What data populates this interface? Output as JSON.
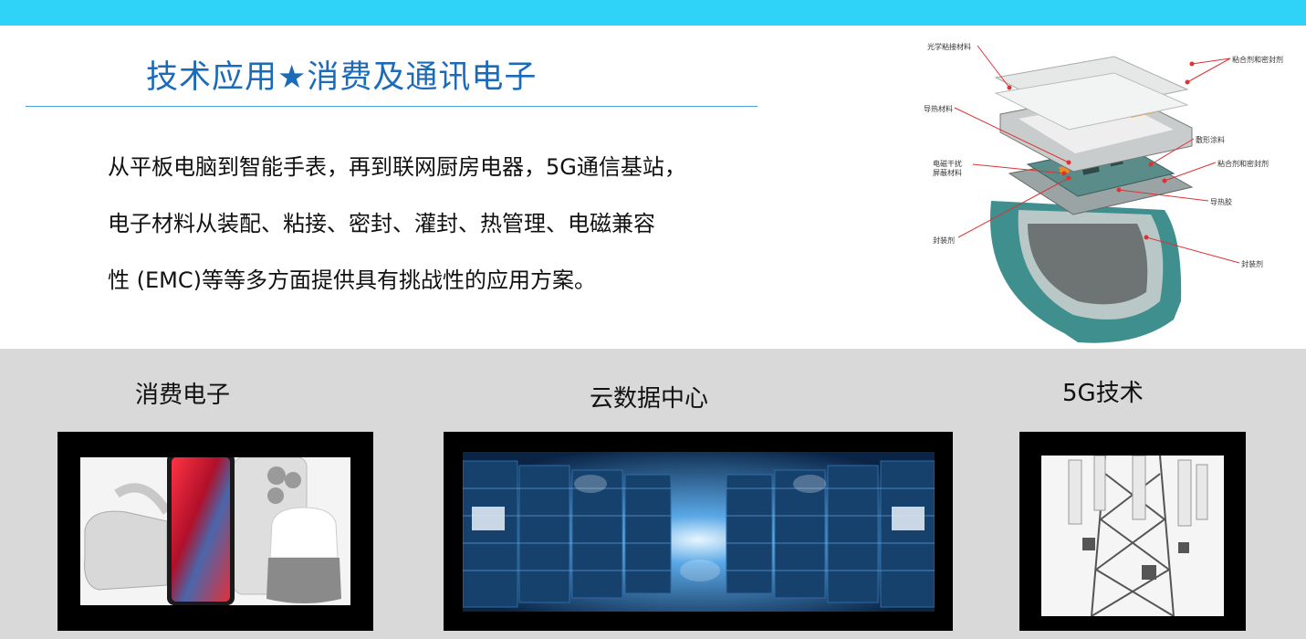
{
  "header": {
    "title": "技术应用★消费及通讯电子"
  },
  "intro": {
    "lines": [
      "从平板电脑到智能手表，再到联网厨房电器，5G通信基站，",
      "电子材料从装配、粘接、密封、灌封、热管理、电磁兼容",
      "性 (EMC)等等多方面提供具有挑战性的应用方案。"
    ]
  },
  "diagram": {
    "callouts": {
      "optical_adhesive": "光学粘接材料",
      "adhesive_sealant_top": "粘合剂和密封剂",
      "thermal_material": "导热材料",
      "conformal_coating": "敷形涂料",
      "emi_shielding_1": "电磁干扰",
      "emi_shielding_2": "屏蔽材料",
      "adhesive_sealant_mid": "粘合剂和密封剂",
      "thermal_gel": "导热胶",
      "sealant_left": "封装剂",
      "sealant_right": "封装剂"
    }
  },
  "sections": [
    {
      "label": "消费电子",
      "icon": "consumer-electronics-photo"
    },
    {
      "label": "云数据中心",
      "icon": "data-center-photo"
    },
    {
      "label": "5G技术",
      "icon": "cell-tower-photo"
    }
  ],
  "colors": {
    "top_bar": "#2fd3f7",
    "title": "#1b6bb8",
    "callout_line": "#dd3333",
    "band": "#d9d9d9"
  }
}
